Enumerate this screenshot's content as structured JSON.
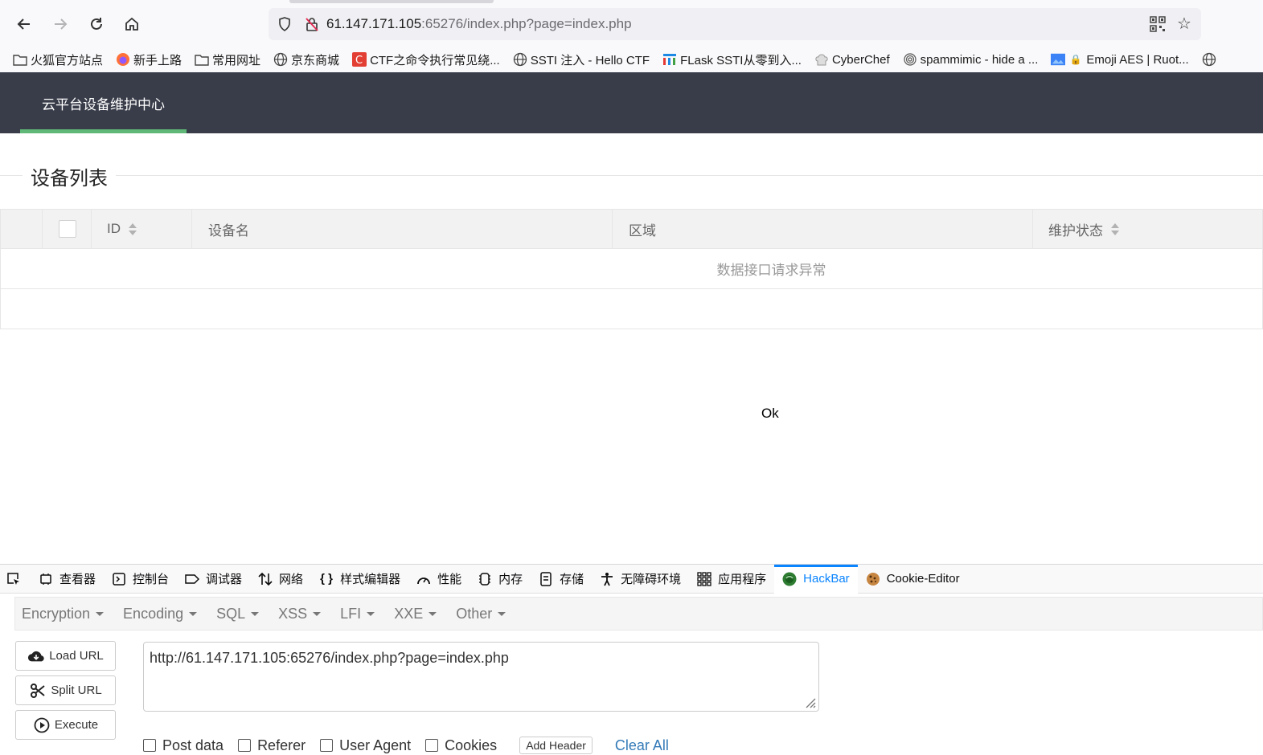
{
  "browser": {
    "url_host": "61.147.171.105",
    "url_rest": ":65276/index.php?page=index.php",
    "bookmarks": [
      "火狐官方站点",
      "新手上路",
      "常用网址",
      "京东商城",
      "CTF之命令执行常见绕...",
      "SSTI 注入 - Hello CTF",
      "FLask SSTI从零到入...",
      "CyberChef",
      "spammimic - hide a ...",
      "Emoji AES | Ruot..."
    ]
  },
  "header": {
    "brand": "云平台设备维护中心"
  },
  "page": {
    "section_title": "设备列表",
    "table": {
      "columns": [
        "ID",
        "设备名",
        "区域",
        "维护状态"
      ],
      "empty_message": "数据接口请求异常"
    },
    "ok_text": "Ok"
  },
  "devtools": {
    "tabs": [
      "查看器",
      "控制台",
      "调试器",
      "网络",
      "样式编辑器",
      "性能",
      "内存",
      "存储",
      "无障碍环境",
      "应用程序",
      "HackBar",
      "Cookie-Editor"
    ],
    "active_tab": "HackBar"
  },
  "hackbar": {
    "menu": [
      "Encryption",
      "Encoding",
      "SQL",
      "XSS",
      "LFI",
      "XXE",
      "Other"
    ],
    "buttons": {
      "load": "Load URL",
      "split": "Split URL",
      "execute": "Execute"
    },
    "url_value": "http://61.147.171.105:65276/index.php?page=index.php",
    "options": {
      "post": "Post data",
      "referer": "Referer",
      "ua": "User Agent",
      "cookies": "Cookies"
    },
    "add_header": "Add Header",
    "clear_all": "Clear All"
  }
}
